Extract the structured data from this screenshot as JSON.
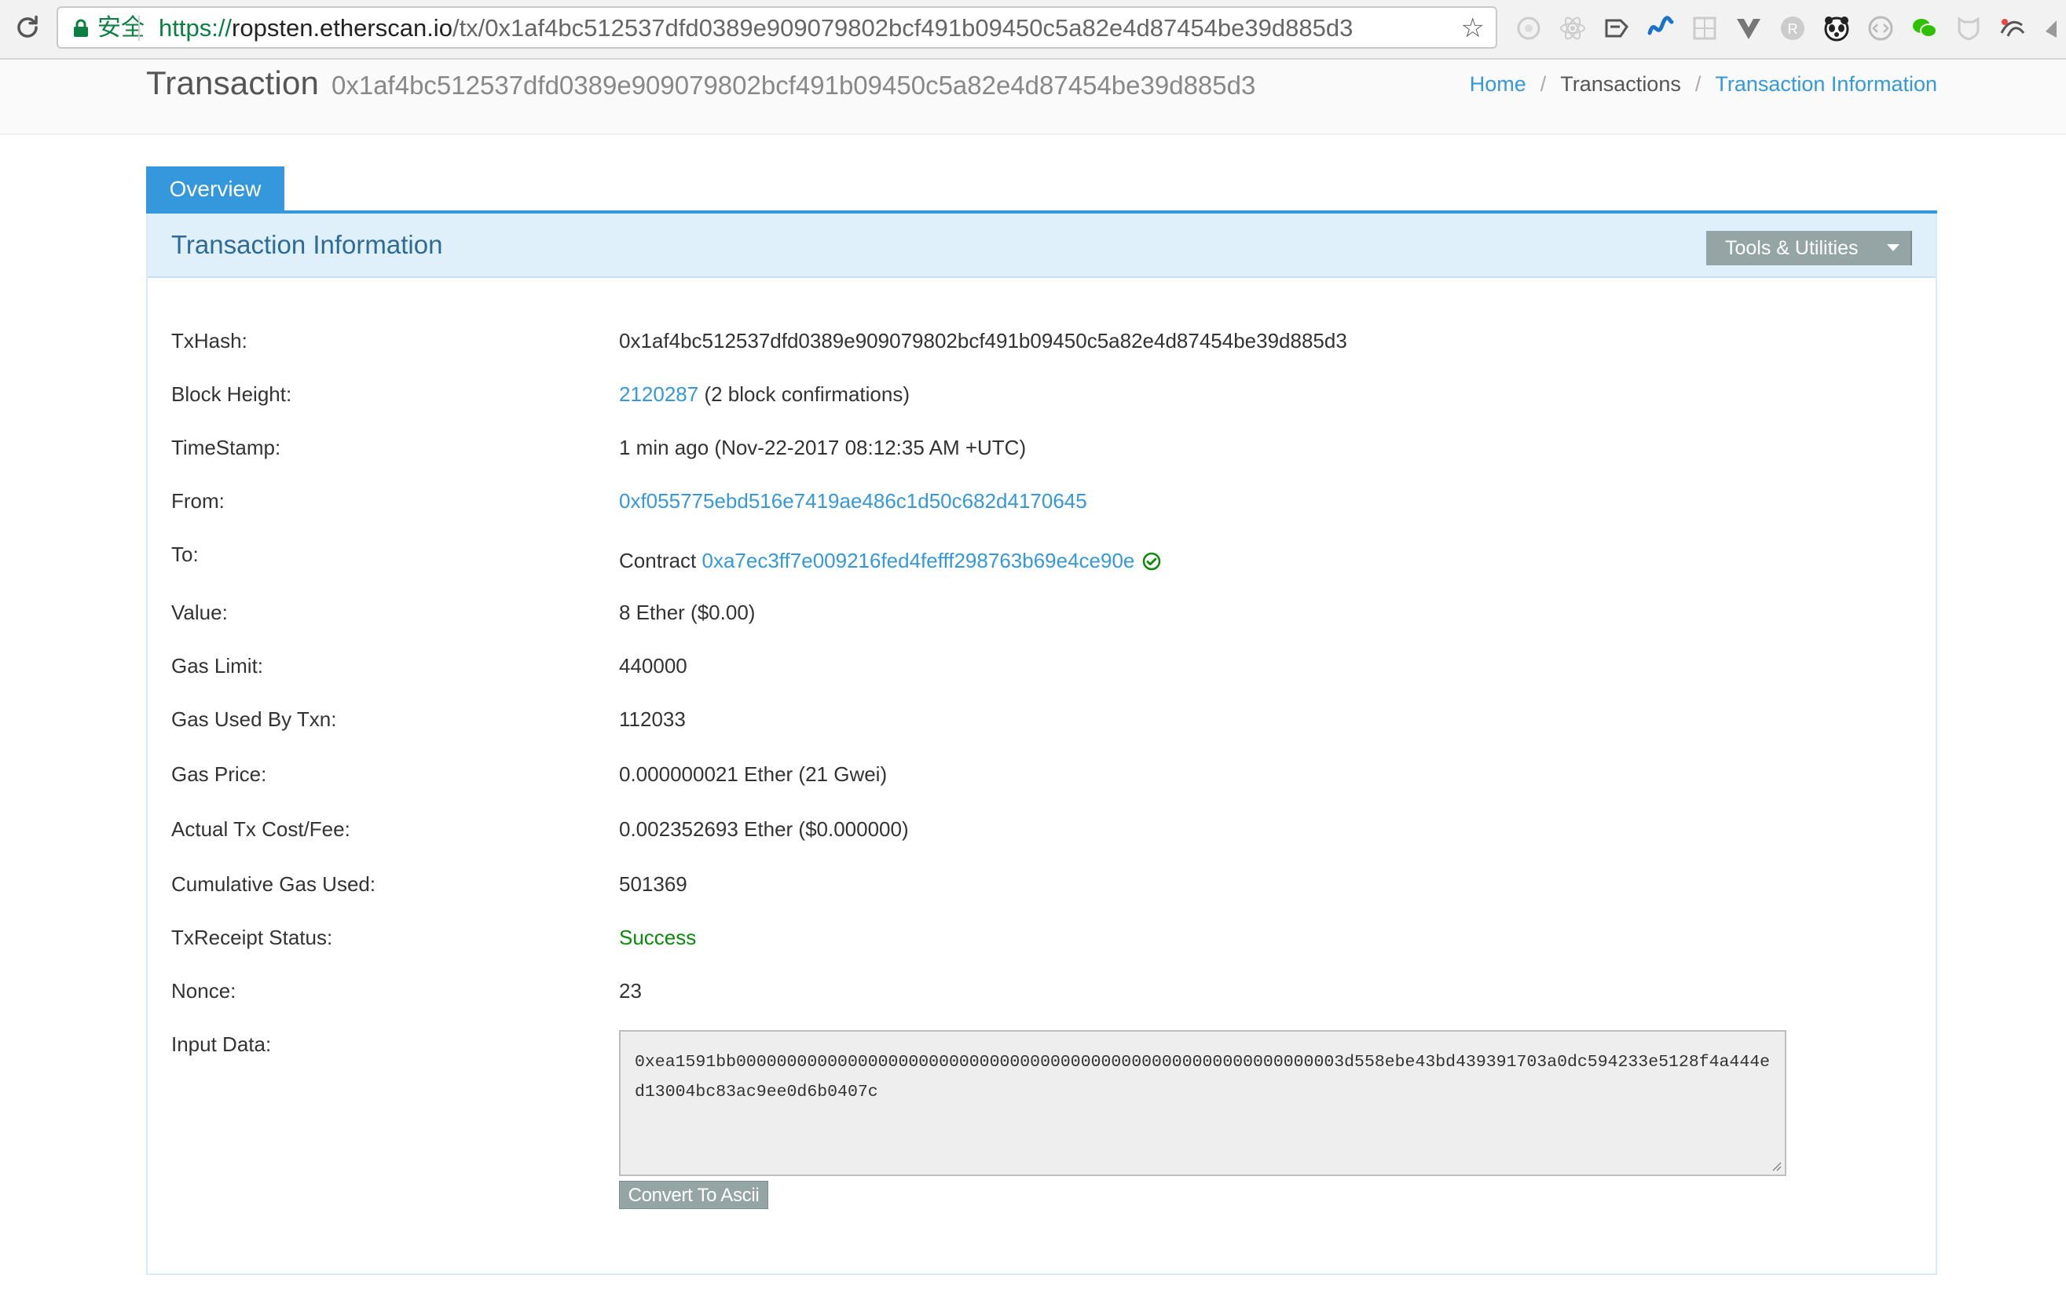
{
  "browser": {
    "secure_label": "安全",
    "url_scheme": "https://",
    "url_host": "ropsten.etherscan.io",
    "url_path": "/tx/0x1af4bc512537dfd0389e909079802bcf491b09450c5a82e4d87454be39d885d3"
  },
  "header": {
    "title": "Transaction",
    "hash": "0x1af4bc512537dfd0389e909079802bcf491b09450c5a82e4d87454be39d885d3",
    "breadcrumb": [
      "Home",
      "Transactions",
      "Transaction Information"
    ],
    "breadcrumb_divider": "/"
  },
  "tabs": [
    {
      "label": "Overview",
      "active": true
    }
  ],
  "panel": {
    "title": "Transaction Information",
    "tools_label": "Tools & Utilities"
  },
  "details": {
    "txhash_label": "TxHash:",
    "txhash": "0x1af4bc512537dfd0389e909079802bcf491b09450c5a82e4d87454be39d885d3",
    "block_label": "Block Height:",
    "block": "2120287",
    "block_conf": " (2 block confirmations)",
    "timestamp_label": "TimeStamp:",
    "timestamp": "1 min ago (Nov-22-2017 08:12:35 AM +UTC)",
    "from_label": "From:",
    "from": "0xf055775ebd516e7419ae486c1d50c682d4170645",
    "to_label": "To:",
    "to_prefix": "Contract ",
    "to": "0xa7ec3ff7e009216fed4fefff298763b69e4ce90e",
    "value_label": "Value:",
    "value": "8 Ether ($0.00)",
    "gas_limit_label": "Gas Limit:",
    "gas_limit": "440000",
    "gas_used_label": "Gas Used By Txn:",
    "gas_used": "112033",
    "gas_price_label": "Gas Price:",
    "gas_price": "0.000000021 Ether (21 Gwei)",
    "fee_label": "Actual Tx Cost/Fee:",
    "fee": "0.002352693 Ether ($0.000000)",
    "cumulative_label": "Cumulative Gas Used:",
    "cumulative": "501369",
    "status_label": "TxReceipt Status:",
    "status": "Success",
    "nonce_label": "Nonce:",
    "nonce": "23",
    "input_label": "Input Data:",
    "input_data": "0xea1591bb000000000000000000000000000000000000000000000000000000000003d558ebe43bd439391703a0dc594233e5128f4a444ed13004bc83ac9ee0d6b0407c",
    "convert_label": "Convert To Ascii"
  },
  "colors": {
    "accent": "#3598dc",
    "link": "#3498db",
    "success": "#0a8a0a",
    "button_grey": "#95a5a6"
  }
}
